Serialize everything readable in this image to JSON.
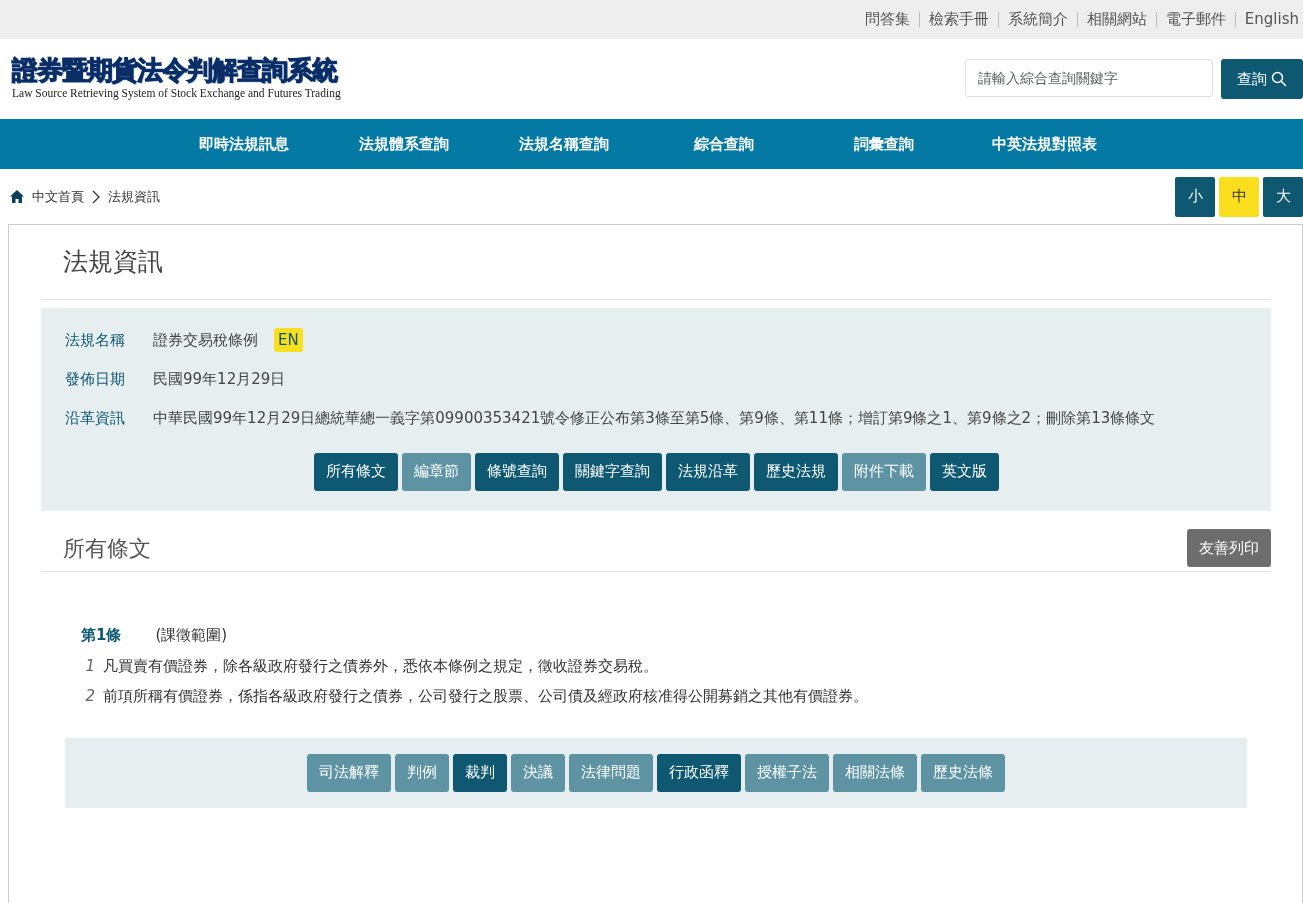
{
  "top_links": [
    "問答集",
    "檢索手冊",
    "系統簡介",
    "相關網站",
    "電子郵件",
    "English"
  ],
  "logo": {
    "title": "證券暨期貨法令判解查詢系統",
    "subtitle": "Law Source Retrieving System of Stock Exchange and Futures Trading"
  },
  "search": {
    "placeholder": "請輸入綜合查詢關鍵字",
    "button": "查詢"
  },
  "nav": [
    "即時法規訊息",
    "法規體系查詢",
    "法規名稱查詢",
    "綜合查詢",
    "詞彙查詢",
    "中英法規對照表"
  ],
  "breadcrumb": [
    "中文首頁",
    "法規資訊"
  ],
  "font_sizes": [
    {
      "label": "小",
      "selected": false
    },
    {
      "label": "中",
      "selected": true
    },
    {
      "label": "大",
      "selected": false
    }
  ],
  "page_title": "法規資訊",
  "info": [
    {
      "label": "法規名稱",
      "value": "證券交易稅條例",
      "badge": "EN"
    },
    {
      "label": "發佈日期",
      "value": "民國99年12月29日"
    },
    {
      "label": "沿革資訊",
      "value": "中華民國99年12月29日總統華總一義字第09900353421號令修正公布第3條至第5條、第9條、第11條；增訂第9條之1、第9條之2；刪除第13條條文"
    }
  ],
  "info_buttons": [
    {
      "label": "所有條文",
      "disabled": false
    },
    {
      "label": "編章節",
      "disabled": true
    },
    {
      "label": "條號查詢",
      "disabled": false
    },
    {
      "label": "關鍵字查詢",
      "disabled": false
    },
    {
      "label": "法規沿革",
      "disabled": false
    },
    {
      "label": "歷史法規",
      "disabled": false
    },
    {
      "label": "附件下載",
      "disabled": true
    },
    {
      "label": "英文版",
      "disabled": false
    }
  ],
  "section": {
    "title": "所有條文",
    "print_button": "友善列印"
  },
  "article": {
    "number": "第1條",
    "caption": "(課徵範圍)",
    "paragraphs": [
      {
        "index": "1",
        "text": "凡買賣有價證券，除各級政府發行之債券外，悉依本條例之規定，徵收證券交易稅。"
      },
      {
        "index": "2",
        "text": "前項所稱有價證券，係指各級政府發行之債券，公司發行之股票、公司債及經政府核准得公開募銷之其他有價證券。"
      }
    ]
  },
  "article_buttons": [
    {
      "label": "司法解釋",
      "disabled": true
    },
    {
      "label": "判例",
      "disabled": true
    },
    {
      "label": "裁判",
      "disabled": false
    },
    {
      "label": "決議",
      "disabled": true
    },
    {
      "label": "法律問題",
      "disabled": true
    },
    {
      "label": "行政函釋",
      "disabled": false
    },
    {
      "label": "授權子法",
      "disabled": true
    },
    {
      "label": "相關法條",
      "disabled": true
    },
    {
      "label": "歷史法條",
      "disabled": true
    }
  ]
}
